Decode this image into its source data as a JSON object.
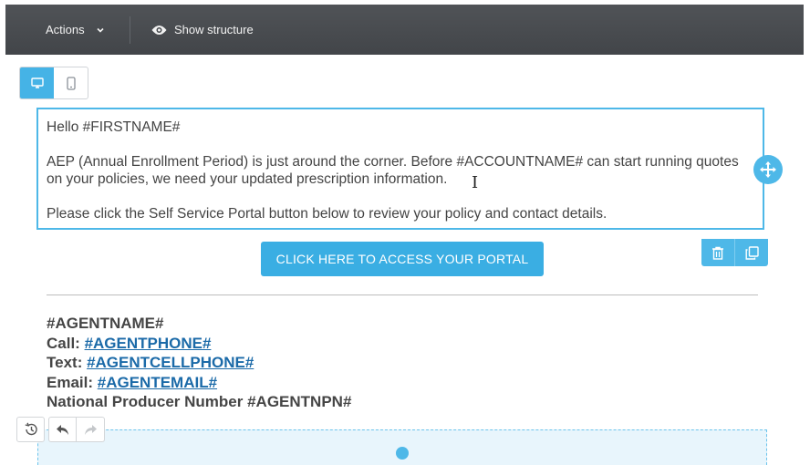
{
  "toolbar": {
    "actions_label": "Actions",
    "show_structure_label": "Show structure"
  },
  "device_toggle": {
    "active": "desktop"
  },
  "text_block": {
    "greeting": "Hello #FIRSTNAME#",
    "paragraph1": "AEP (Annual Enrollment Period) is just around the corner. Before #ACCOUNTNAME# can start running quotes on your policies, we need your updated prescription information.",
    "paragraph2": "Please click the Self Service Portal button below to review your policy and contact details."
  },
  "portal_button": {
    "label": "CLICK HERE TO ACCESS YOUR PORTAL"
  },
  "signature": {
    "agent_name": "#AGENTNAME#",
    "call_label": "Call: ",
    "call_value": "#AGENTPHONE# ",
    "text_label": "Text: ",
    "text_value": "#AGENTCELLPHONE#",
    "email_label": "Email: ",
    "email_value": "#AGENTEMAIL#",
    "npn_line": "National Producer Number #AGENTNPN#"
  },
  "colors": {
    "accent": "#4eb8e8",
    "button": "#3aaee3",
    "toolbar": "#46494d",
    "link": "#1b6aa8"
  }
}
